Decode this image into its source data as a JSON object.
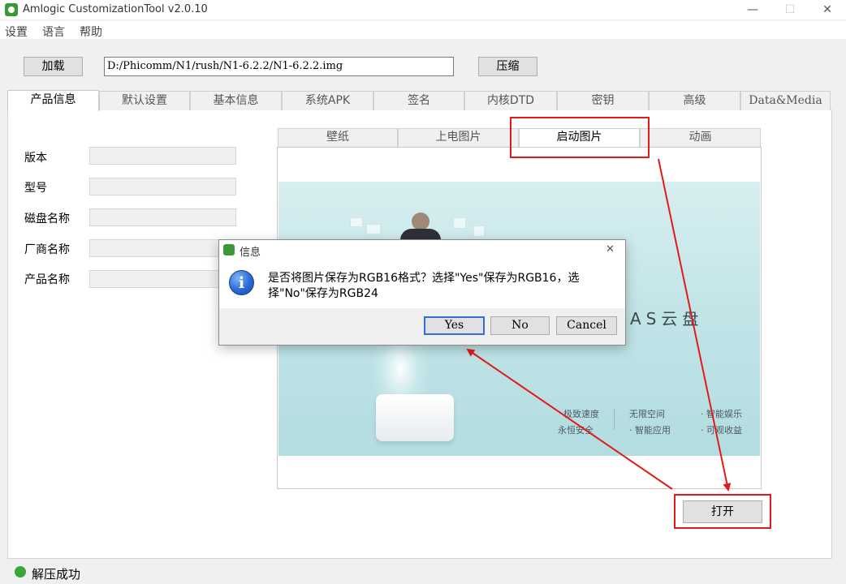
{
  "window": {
    "title": "Amlogic CustomizationTool v2.0.10",
    "minimize": "—",
    "maximize": "☐",
    "close": "✕"
  },
  "menu": [
    "设置",
    "语言",
    "帮助"
  ],
  "toolbar": {
    "load_label": "加载",
    "path_value": "D:/Phicomm/N1/rush/N1-6.2.2/N1-6.2.2.img",
    "compress_label": "压缩"
  },
  "tabs": [
    "产品信息",
    "默认设置",
    "基本信息",
    "系统APK",
    "签名",
    "内核DTD",
    "密钥",
    "高级",
    "Data&Media"
  ],
  "active_tab": "产品信息",
  "fields": [
    {
      "label": "版本",
      "value": ""
    },
    {
      "label": "型号",
      "value": ""
    },
    {
      "label": "磁盘名称",
      "value": ""
    },
    {
      "label": "厂商名称",
      "value": ""
    },
    {
      "label": "产品名称",
      "value": ""
    }
  ],
  "inner_tabs": [
    "壁纸",
    "上电图片",
    "启动图片",
    "动画"
  ],
  "active_inner_tab": "启动图片",
  "splash": {
    "brand": "NAS云盘",
    "features": [
      "极致速度",
      "无限空间",
      "· 智能娱乐",
      "永恒安全",
      "· 智能应用",
      "· 可观收益"
    ]
  },
  "open_button": "打开",
  "dialog": {
    "title": "信息",
    "message_line1": "是否将图片保存为RGB16格式？选择\"Yes\"保存为RGB16，选",
    "message_line2": "择\"No\"保存为RGB24",
    "buttons": [
      "Yes",
      "No",
      "Cancel"
    ]
  },
  "status": {
    "text": "解压成功",
    "color": "#3aa53a"
  },
  "accent": {
    "highlight_red": "#e21a1a"
  }
}
